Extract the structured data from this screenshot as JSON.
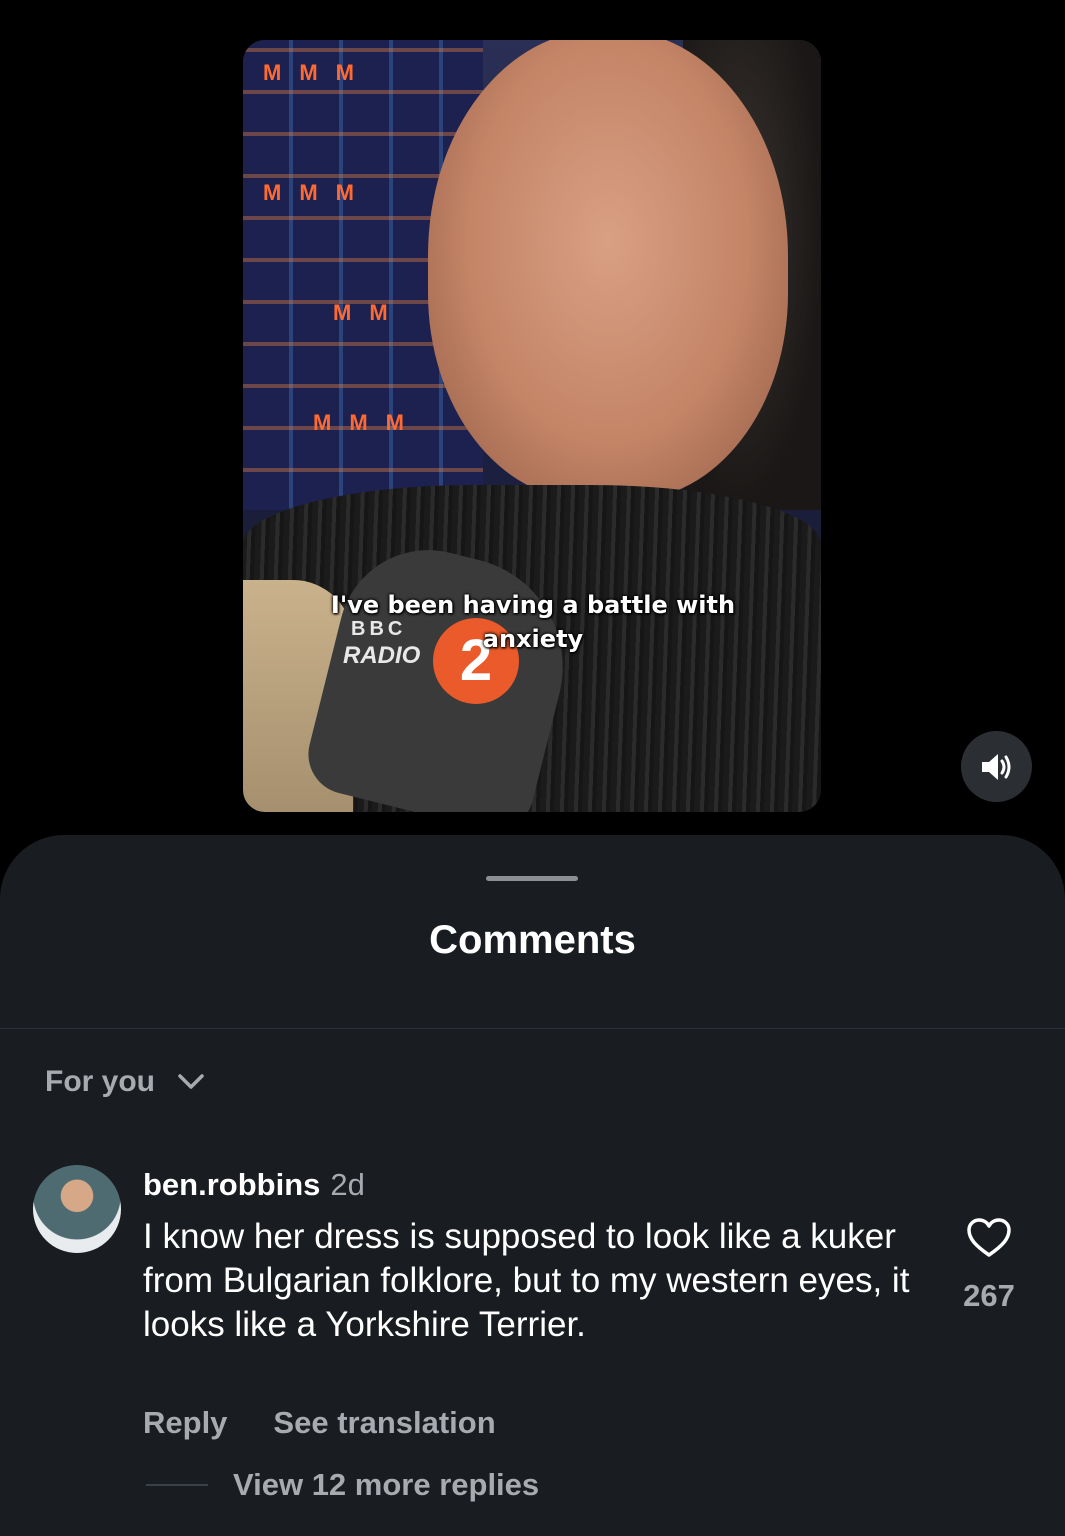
{
  "video": {
    "caption": "I've been having a battle with anxiety",
    "mic_brand": "BBC",
    "mic_label": "RADIO",
    "mic_number": "2",
    "sound_icon": "speaker-volume-icon"
  },
  "comments_sheet": {
    "title": "Comments",
    "sort_label": "For you",
    "sort_icon": "chevron-down-icon"
  },
  "comment": {
    "username": "ben.robbins",
    "time": "2d",
    "text": "I know her dress is supposed to look like a kuker from Bulgarian folklore, but to my western eyes, it looks like a Yorkshire Terrier.",
    "like_icon": "heart-icon",
    "like_count": "267",
    "reply_label": "Reply",
    "translate_label": "See translation",
    "view_replies_label": "View 12 more replies"
  },
  "colors": {
    "background": "#000000",
    "sheet": "#191c20",
    "secondary_text": "#a7abb0",
    "primary_text": "#ffffff"
  }
}
